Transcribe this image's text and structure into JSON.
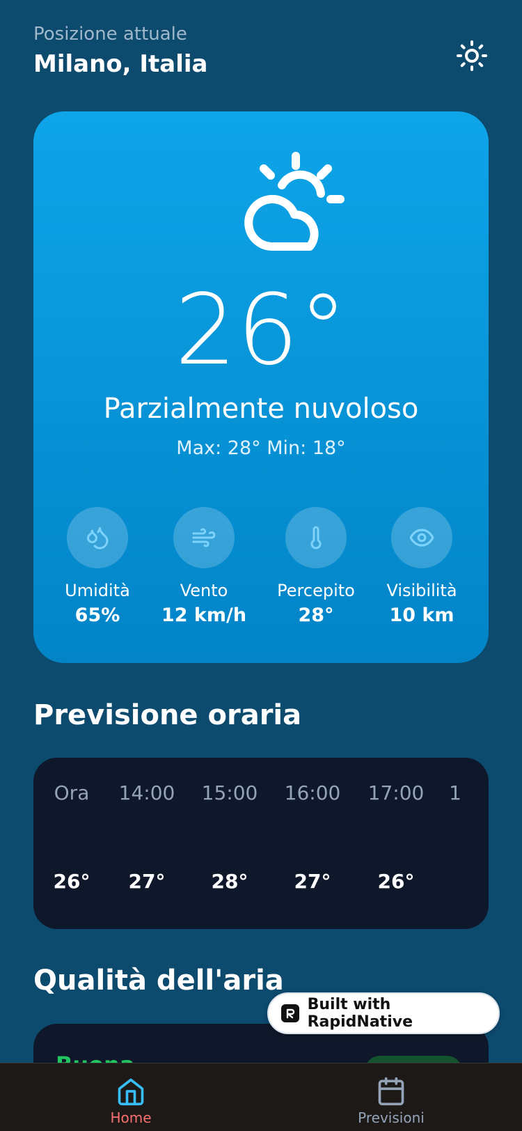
{
  "header": {
    "location_label": "Posizione attuale",
    "city": "Milano, Italia"
  },
  "current": {
    "temperature": "26°",
    "condition": "Parzialmente nuvoloso",
    "minmax": "Max: 28° Min: 18°"
  },
  "stats": [
    {
      "label": "Umidità",
      "value": "65%",
      "icon": "droplets-icon"
    },
    {
      "label": "Vento",
      "value": "12 km/h",
      "icon": "wind-icon"
    },
    {
      "label": "Percepito",
      "value": "28°",
      "icon": "thermometer-icon"
    },
    {
      "label": "Visibilità",
      "value": "10 km",
      "icon": "eye-icon"
    }
  ],
  "hourly": {
    "title": "Previsione oraria",
    "items": [
      {
        "time": "Ora",
        "temp": "26°"
      },
      {
        "time": "14:00",
        "temp": "27°"
      },
      {
        "time": "15:00",
        "temp": "28°"
      },
      {
        "time": "16:00",
        "temp": "27°"
      },
      {
        "time": "17:00",
        "temp": "26°"
      },
      {
        "time": "1",
        "temp": ""
      }
    ]
  },
  "air_quality": {
    "title": "Qualità dell'aria",
    "status": "Buona"
  },
  "badge": {
    "text": "Built with RapidNative"
  },
  "tabbar": {
    "items": [
      {
        "label": "Home",
        "active": true
      },
      {
        "label": "Previsioni",
        "active": false
      }
    ]
  },
  "colors": {
    "background": "#0c4a6e",
    "card_gradient_top": "#0ea5e9",
    "card_gradient_bottom": "#0284c7",
    "dark_card": "#0f172a",
    "tab_active": "#38bdf8",
    "tab_active_label": "#f87171",
    "aq_good": "#22c55e"
  }
}
